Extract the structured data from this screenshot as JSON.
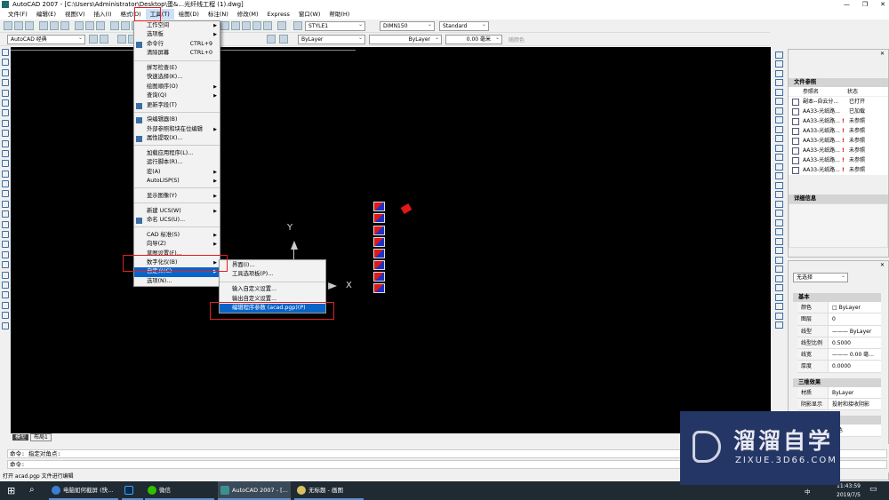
{
  "window": {
    "title": "AutoCAD 2007 - [C:\\Users\\Administrator\\Desktop\\蛋&...光纤线工程 (1).dwg]",
    "controls": [
      "—",
      "❐",
      "✕"
    ]
  },
  "menubar": [
    "文件(F)",
    "编辑(E)",
    "视图(V)",
    "插入(I)",
    "格式(O)",
    "工具(T)",
    "绘图(D)",
    "标注(N)",
    "修改(M)",
    "Express",
    "窗口(W)",
    "帮助(H)"
  ],
  "toolbar": {
    "workspace": "AutoCAD 经典",
    "text_style": "STYLE1",
    "dim_style": "DIMN150",
    "table_style": "Standard",
    "color": "ByLayer",
    "linetype": "ByLayer",
    "lineweight": "0.00 毫米",
    "plotstyle": "随颜色"
  },
  "tools_menu": [
    {
      "label": "工作空间",
      "arrow": true
    },
    {
      "label": "选项板",
      "arrow": true
    },
    {
      "label": "命令行",
      "shortcut": "CTRL+9",
      "icon": "command-line-icon"
    },
    {
      "label": "清除屏幕",
      "shortcut": "CTRL+0"
    },
    {
      "sep": true
    },
    {
      "label": "拼写检查(E)"
    },
    {
      "label": "快速选择(K)..."
    },
    {
      "label": "绘图顺序(O)",
      "arrow": true
    },
    {
      "label": "查询(Q)",
      "arrow": true
    },
    {
      "label": "更新字段(T)",
      "icon": "update-field-icon"
    },
    {
      "sep": true
    },
    {
      "label": "块编辑器(B)",
      "icon": "block-editor-icon"
    },
    {
      "label": "外部参照和块在位编辑",
      "arrow": true
    },
    {
      "label": "属性提取(X)...",
      "icon": "attribute-extract-icon"
    },
    {
      "sep": true
    },
    {
      "label": "加载应用程序(L)..."
    },
    {
      "label": "运行脚本(R)..."
    },
    {
      "label": "宏(A)",
      "arrow": true
    },
    {
      "label": "AutoLISP(S)",
      "arrow": true
    },
    {
      "sep": true
    },
    {
      "label": "显示图像(Y)",
      "arrow": true
    },
    {
      "sep": true
    },
    {
      "label": "新建 UCS(W)",
      "arrow": true
    },
    {
      "label": "命名 UCS(U)...",
      "icon": "ucs-icon"
    },
    {
      "sep": true
    },
    {
      "label": "CAD 标准(S)",
      "arrow": true
    },
    {
      "label": "向导(Z)",
      "arrow": true
    },
    {
      "label": "草图设置(F)..."
    },
    {
      "label": "数字化仪(B)",
      "arrow": true
    },
    {
      "label": "自定义(C)",
      "arrow": true,
      "highlight": true
    },
    {
      "label": "选项(N)..."
    }
  ],
  "customize_submenu": [
    {
      "label": "界面(I)..."
    },
    {
      "label": "工具选项板(P)..."
    },
    {
      "sep": true
    },
    {
      "label": "输入自定义设置..."
    },
    {
      "label": "输出自定义设置..."
    },
    {
      "label": "编辑程序参数 (acad.pgp)(P)",
      "highlight": true
    }
  ],
  "canvas": {
    "axis_x": "X",
    "axis_y": "Y"
  },
  "xref_panel": {
    "title": "文件参照",
    "col_name": "参照名",
    "col_status": "状态",
    "rows": [
      {
        "name": "副本--自云分...",
        "status": "已打开",
        "warn": false
      },
      {
        "name": "AA33-光纸路...",
        "status": "已加载",
        "warn": false
      },
      {
        "name": "AA33-光纸路...",
        "status": "未参照",
        "warn": true
      },
      {
        "name": "AA33-光纸路...",
        "status": "未参照",
        "warn": true
      },
      {
        "name": "AA33-光纸路...",
        "status": "未参照",
        "warn": true
      },
      {
        "name": "AA33-光纸路...",
        "status": "未参照",
        "warn": true
      },
      {
        "name": "AA33-光纸路...",
        "status": "未参照",
        "warn": true
      },
      {
        "name": "AA33-光纸路...",
        "status": "未参照",
        "warn": true
      }
    ],
    "details": "详细信息"
  },
  "properties": {
    "selection": "无选择",
    "basic": "基本",
    "rows": [
      [
        "颜色",
        "□ ByLayer"
      ],
      [
        "图层",
        "0"
      ],
      [
        "线型",
        "——— ByLayer"
      ],
      [
        "线型比例",
        "0.5000"
      ],
      [
        "线宽",
        "——— 0.00 毫..."
      ],
      [
        "厚度",
        "0.0000"
      ]
    ],
    "three_d": "三维效果",
    "rows3d": [
      [
        "材质",
        "ByLayer"
      ],
      [
        "阴影显示",
        "投射和接收阴影"
      ]
    ],
    "more": "颜色"
  },
  "layout_tabs": [
    "模型",
    "布局1"
  ],
  "command": {
    "line1": "命令: 指定对角点:",
    "line2": "命令:"
  },
  "status": "打开 acad.pgp 文件进行编辑",
  "taskbar": {
    "tasks": [
      "电脑如何截屏 (快...",
      "",
      "微信",
      "AutoCAD 2007 - [...",
      "无标题 - 画图"
    ],
    "time": "11:43:59",
    "date": "2019/7/5",
    "ime": "中"
  },
  "watermark": {
    "name": "溜溜自学",
    "url": "ZIXUE.3D66.COM"
  },
  "colors": {
    "highlight": "#0a64c8",
    "annotation": "#e02020",
    "canvas": "#000000",
    "watermark": "#243666"
  }
}
